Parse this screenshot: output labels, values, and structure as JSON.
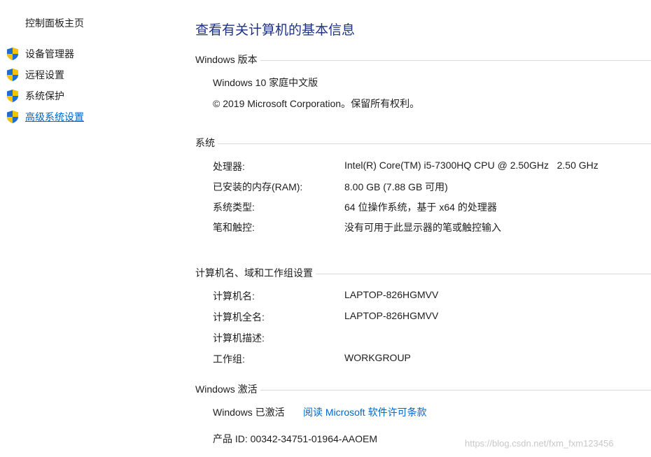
{
  "sidebar": {
    "home": "控制面板主页",
    "items": [
      {
        "label": "设备管理器",
        "icon": "uac-shield-icon"
      },
      {
        "label": "远程设置",
        "icon": "uac-shield-icon"
      },
      {
        "label": "系统保护",
        "icon": "uac-shield-icon"
      },
      {
        "label": "高级系统设置",
        "icon": "uac-shield-icon"
      }
    ]
  },
  "main": {
    "title": "查看有关计算机的基本信息",
    "windows_edition": {
      "heading": "Windows 版本",
      "edition": "Windows 10 家庭中文版",
      "copyright": "© 2019 Microsoft Corporation。保留所有权利。"
    },
    "system": {
      "heading": "系统",
      "rows": [
        {
          "label": "处理器:",
          "value": "Intel(R) Core(TM) i5-7300HQ CPU @ 2.50GHz   2.50 GHz"
        },
        {
          "label": "已安装的内存(RAM):",
          "value": "8.00 GB (7.88 GB 可用)"
        },
        {
          "label": "系统类型:",
          "value": "64 位操作系统，基于 x64 的处理器"
        },
        {
          "label": "笔和触控:",
          "value": "没有可用于此显示器的笔或触控输入"
        }
      ]
    },
    "computer_name": {
      "heading": "计算机名、域和工作组设置",
      "rows": [
        {
          "label": "计算机名:",
          "value": "LAPTOP-826HGMVV"
        },
        {
          "label": "计算机全名:",
          "value": "LAPTOP-826HGMVV"
        },
        {
          "label": "计算机描述:",
          "value": ""
        },
        {
          "label": "工作组:",
          "value": "WORKGROUP"
        }
      ]
    },
    "activation": {
      "heading": "Windows 激活",
      "status": "Windows 已激活",
      "license_link": "阅读 Microsoft 软件许可条款",
      "product_id": "产品 ID: 00342-34751-01964-AAOEM"
    }
  },
  "watermark": "https://blog.csdn.net/fxm_fxm123456",
  "colors": {
    "title": "#1e3287",
    "link": "#0066cc",
    "divider": "#d9d9d9",
    "shield_blue": "#1c6fd0",
    "shield_yellow": "#f5c400"
  }
}
